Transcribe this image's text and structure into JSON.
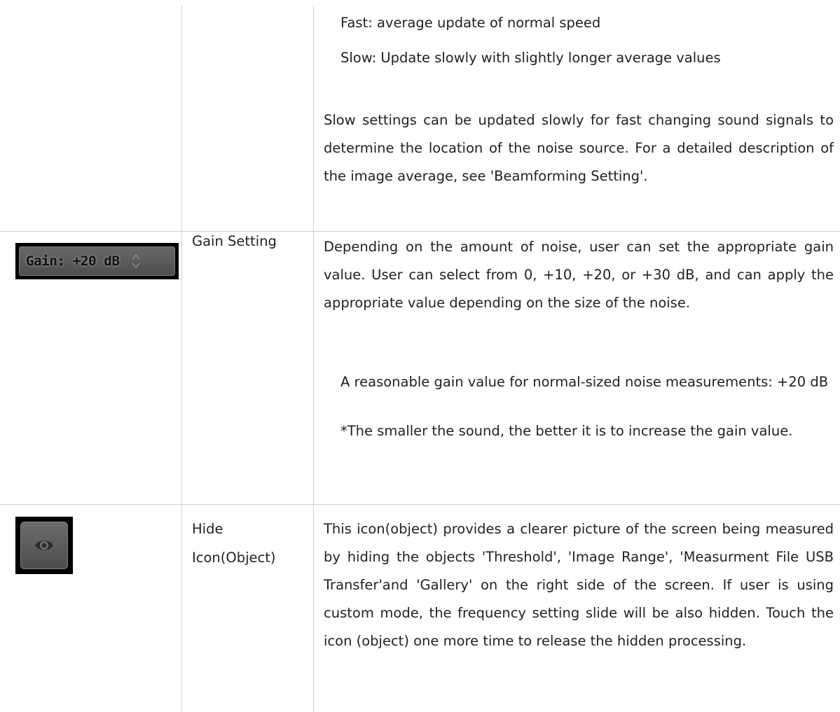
{
  "row_speed": {
    "fast_line": "Fast: average update of normal speed",
    "slow_line": "Slow: Update slowly with slightly longer average values",
    "paragraph": "Slow settings can be updated slowly for fast changing sound signals to determine the location of the noise source. For a detailed description of the image average, see 'Beamforming Setting'."
  },
  "row_gain": {
    "widget_label": "Gain: +20 dB",
    "name": "Gain Setting",
    "paragraph": "Depending on the amount of noise, user can set the appropriate gain value. User can select from 0, +10, +20, or +30 dB, and can apply the appropriate value depending on the size of the noise.",
    "note_1": "A reasonable gain value for normal-sized noise measurements: +20 dB",
    "note_2": "*The smaller the sound, the better it is to increase the gain value."
  },
  "row_hide": {
    "icon": "eye-icon",
    "name_line1": "Hide",
    "name_line2": "Icon(Object)",
    "paragraph": "This icon(object) provides a clearer picture of the screen being measured by hiding the objects 'Threshold', 'Image Range', 'Measurment File USB Transfer'and 'Gallery' on the right side of the screen. If user is using custom mode, the frequency setting slide will be also hidden. Touch the icon (object) one more time to release the hidden processing."
  }
}
